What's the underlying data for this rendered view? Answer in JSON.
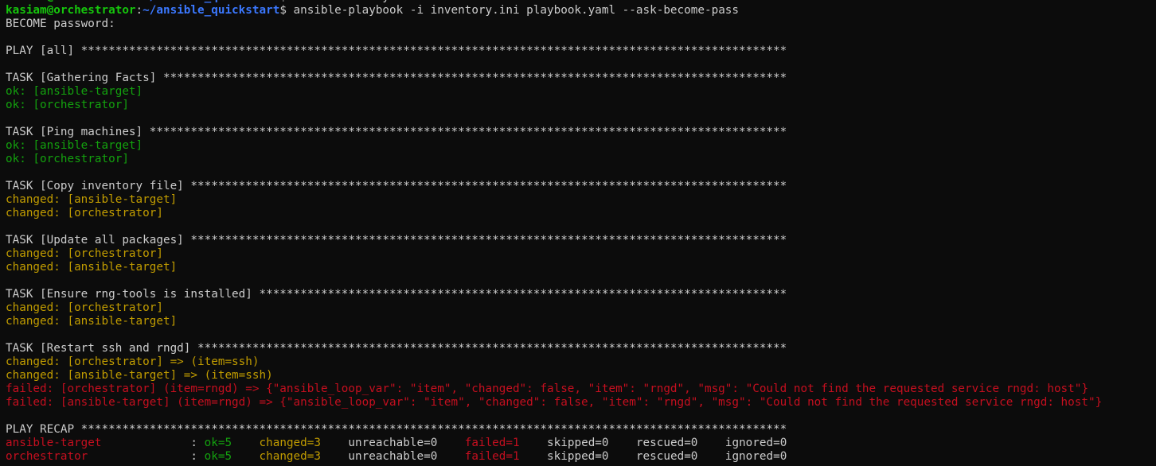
{
  "colors": {
    "background": "#0c0c0c",
    "default_text": "#cccccc",
    "ok_green": "#13a10e",
    "prompt_green": "#16c60c",
    "path_blue": "#3b78ff",
    "changed_yellow": "#c19c00",
    "failed_red": "#c50f1f"
  },
  "lines": [
    [
      {
        "t": "kasiam@orchestrator",
        "c": "bold-green"
      },
      {
        "t": ":",
        "c": "gray"
      },
      {
        "t": "~/ansible_quickstart",
        "c": "bold-blue"
      },
      {
        "t": "$ nano inventory.ini",
        "c": "gray"
      }
    ],
    [
      {
        "t": "kasiam@orchestrator",
        "c": "bold-green"
      },
      {
        "t": ":",
        "c": "gray"
      },
      {
        "t": "~/ansible_quickstart",
        "c": "bold-blue"
      },
      {
        "t": "$ ansible-playbook -i inventory.ini playbook.yaml --ask-become-pass",
        "c": "gray"
      }
    ],
    [
      {
        "t": "BECOME password:",
        "c": "gray"
      }
    ],
    [],
    [
      {
        "t": "PLAY [all] *******************************************************************************************************",
        "c": "gray"
      }
    ],
    [],
    [
      {
        "t": "TASK [Gathering Facts] *******************************************************************************************",
        "c": "gray"
      }
    ],
    [
      {
        "t": "ok: [ansible-target]",
        "c": "green"
      }
    ],
    [
      {
        "t": "ok: [orchestrator]",
        "c": "green"
      }
    ],
    [],
    [
      {
        "t": "TASK [Ping machines] *********************************************************************************************",
        "c": "gray"
      }
    ],
    [
      {
        "t": "ok: [ansible-target]",
        "c": "green"
      }
    ],
    [
      {
        "t": "ok: [orchestrator]",
        "c": "green"
      }
    ],
    [],
    [
      {
        "t": "TASK [Copy inventory file] ***************************************************************************************",
        "c": "gray"
      }
    ],
    [
      {
        "t": "changed: [ansible-target]",
        "c": "yellow"
      }
    ],
    [
      {
        "t": "changed: [orchestrator]",
        "c": "yellow"
      }
    ],
    [],
    [
      {
        "t": "TASK [Update all packages] ***************************************************************************************",
        "c": "gray"
      }
    ],
    [
      {
        "t": "changed: [orchestrator]",
        "c": "yellow"
      }
    ],
    [
      {
        "t": "changed: [ansible-target]",
        "c": "yellow"
      }
    ],
    [],
    [
      {
        "t": "TASK [Ensure rng-tools is installed] *****************************************************************************",
        "c": "gray"
      }
    ],
    [
      {
        "t": "changed: [orchestrator]",
        "c": "yellow"
      }
    ],
    [
      {
        "t": "changed: [ansible-target]",
        "c": "yellow"
      }
    ],
    [],
    [
      {
        "t": "TASK [Restart ssh and rngd] **************************************************************************************",
        "c": "gray"
      }
    ],
    [
      {
        "t": "changed: [orchestrator] => (item=ssh)",
        "c": "yellow"
      }
    ],
    [
      {
        "t": "changed: [ansible-target] => (item=ssh)",
        "c": "yellow"
      }
    ],
    [
      {
        "t": "failed: [orchestrator] (item=rngd) => {\"ansible_loop_var\": \"item\", \"changed\": false, \"item\": \"rngd\", \"msg\": \"Could not find the requested service rngd: host\"}",
        "c": "red"
      }
    ],
    [
      {
        "t": "failed: [ansible-target] (item=rngd) => {\"ansible_loop_var\": \"item\", \"changed\": false, \"item\": \"rngd\", \"msg\": \"Could not find the requested service rngd: host\"}",
        "c": "red"
      }
    ],
    [],
    [
      {
        "t": "PLAY RECAP *******************************************************************************************************",
        "c": "gray"
      }
    ],
    [
      {
        "t": "ansible-target",
        "c": "red"
      },
      {
        "t": "             : ",
        "c": "gray"
      },
      {
        "t": "ok=5",
        "c": "green"
      },
      {
        "t": "    ",
        "c": "gray"
      },
      {
        "t": "changed=3",
        "c": "yellow"
      },
      {
        "t": "    unreachable=0    ",
        "c": "gray"
      },
      {
        "t": "failed=1",
        "c": "red"
      },
      {
        "t": "    skipped=0    rescued=0    ignored=0",
        "c": "gray"
      }
    ],
    [
      {
        "t": "orchestrator",
        "c": "red"
      },
      {
        "t": "               : ",
        "c": "gray"
      },
      {
        "t": "ok=5",
        "c": "green"
      },
      {
        "t": "    ",
        "c": "gray"
      },
      {
        "t": "changed=3",
        "c": "yellow"
      },
      {
        "t": "    unreachable=0    ",
        "c": "gray"
      },
      {
        "t": "failed=1",
        "c": "red"
      },
      {
        "t": "    skipped=0    rescued=0    ignored=0",
        "c": "gray"
      }
    ]
  ]
}
